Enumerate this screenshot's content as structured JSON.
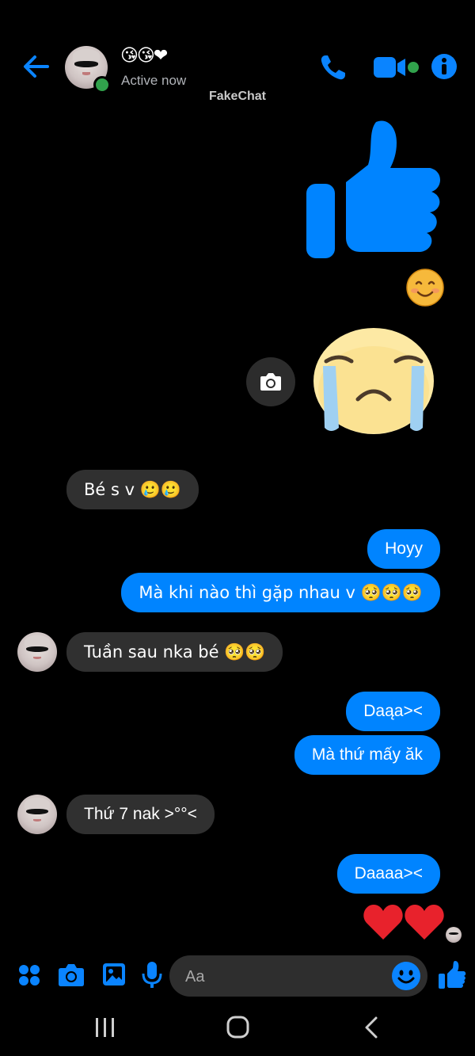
{
  "header": {
    "contact_name": "😘😘❤",
    "status": "Active now",
    "brand_label": "FakeChat"
  },
  "messages": {
    "thumbs_up": "👍",
    "smiling": "😊",
    "crying_sticker": "😭",
    "in_1": "Bé s v 🥲🥲",
    "out_1": "Hoyy",
    "out_2": "Mà khi nào thì gặp nhau v  🥺🥺🥺",
    "in_2": "Tuần sau nka bé 🥺🥺",
    "out_3": "Daąa><",
    "out_4": "Mà thứ mấy ăk",
    "in_3": "Thứ 7 nak >°°<",
    "out_5": "Daaaa><",
    "hearts": "❤❤"
  },
  "composer": {
    "placeholder": "Aa"
  },
  "colors": {
    "accent": "#0084ff",
    "incoming_bubble": "#303030",
    "online": "#31a24c",
    "background": "#000000"
  },
  "icons": [
    "back-arrow-icon",
    "phone-icon",
    "video-icon",
    "info-icon",
    "camera-icon",
    "apps-icon",
    "gallery-icon",
    "microphone-icon",
    "emoji-icon",
    "like-icon",
    "recents-icon",
    "home-icon",
    "nav-back-icon"
  ]
}
